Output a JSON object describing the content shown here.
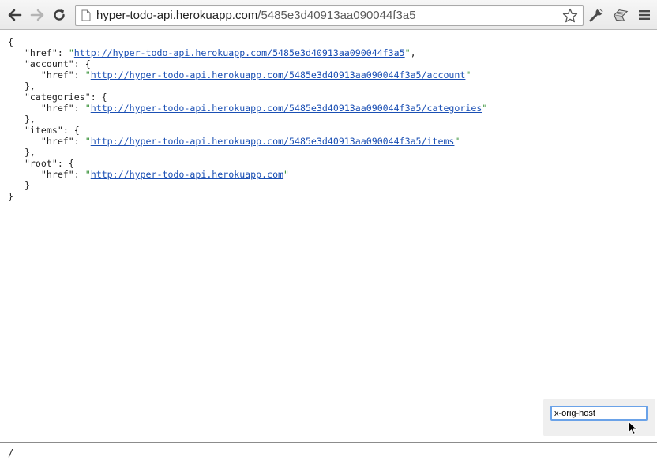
{
  "toolbar": {
    "url_host": "hyper-todo-api.herokuapp.com",
    "url_path": "/5485e3d40913aa090044f3a5",
    "icons": [
      "back-arrow-icon",
      "forward-arrow-icon",
      "reload-icon",
      "page-icon",
      "star-icon",
      "wrench-icon",
      "extension-icon",
      "menu-icon"
    ]
  },
  "json": {
    "lines": [
      {
        "type": "plain",
        "text": "{"
      },
      {
        "type": "href",
        "indent": "   ",
        "key": "\"href\"",
        "sep": ": ",
        "q1": "\"",
        "link": "http://hyper-todo-api.herokuapp.com/5485e3d40913aa090044f3a5",
        "q2": "\"",
        "tail": ","
      },
      {
        "type": "open",
        "indent": "   ",
        "key": "\"account\"",
        "rest": ": {"
      },
      {
        "type": "href",
        "indent": "      ",
        "key": "\"href\"",
        "sep": ": ",
        "q1": "\"",
        "link": "http://hyper-todo-api.herokuapp.com/5485e3d40913aa090044f3a5/account",
        "q2": "\"",
        "tail": ""
      },
      {
        "type": "plain",
        "text": "   },"
      },
      {
        "type": "open",
        "indent": "   ",
        "key": "\"categories\"",
        "rest": ": {"
      },
      {
        "type": "href",
        "indent": "      ",
        "key": "\"href\"",
        "sep": ": ",
        "q1": "\"",
        "link": "http://hyper-todo-api.herokuapp.com/5485e3d40913aa090044f3a5/categories",
        "q2": "\"",
        "tail": ""
      },
      {
        "type": "plain",
        "text": "   },"
      },
      {
        "type": "open",
        "indent": "   ",
        "key": "\"items\"",
        "rest": ": {"
      },
      {
        "type": "href",
        "indent": "      ",
        "key": "\"href\"",
        "sep": ": ",
        "q1": "\"",
        "link": "http://hyper-todo-api.herokuapp.com/5485e3d40913aa090044f3a5/items",
        "q2": "\"",
        "tail": ""
      },
      {
        "type": "plain",
        "text": "   },"
      },
      {
        "type": "open",
        "indent": "   ",
        "key": "\"root\"",
        "rest": ": {"
      },
      {
        "type": "href",
        "indent": "      ",
        "key": "\"href\"",
        "sep": ": ",
        "q1": "\"",
        "link": "http://hyper-todo-api.herokuapp.com",
        "q2": "\"",
        "tail": ""
      },
      {
        "type": "plain",
        "text": "   }"
      },
      {
        "type": "plain",
        "text": "}"
      }
    ]
  },
  "popup": {
    "input_value": "x-orig-host"
  },
  "bottom": {
    "text": "/"
  },
  "colors": {
    "link": "#1a4fb4",
    "string_quote": "#2a8a2a",
    "input_focus": "#6aa2e8"
  }
}
